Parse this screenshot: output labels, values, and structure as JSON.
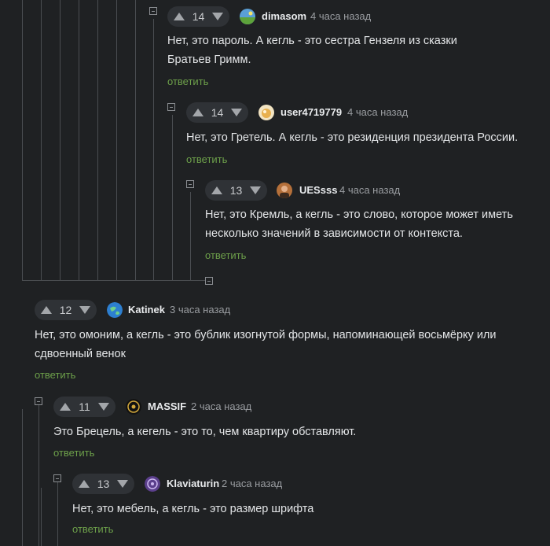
{
  "comments": [
    {
      "votes": "14",
      "author": "dimasom",
      "time": "4 часа назад",
      "text_lines": [
        "Нет, это пароль. А кегль - это сестра Гензеля из сказки",
        "Братьев Гримм."
      ],
      "reply": "ответить",
      "avatar": "landscape-avatar"
    },
    {
      "votes": "14",
      "author": "user4719779",
      "time": "4 часа назад",
      "text_lines": [
        "Нет, это Гретель. А кегль - это резиденция президента России."
      ],
      "reply": "ответить",
      "avatar": "food-avatar"
    },
    {
      "votes": "13",
      "author": "UESsss",
      "time": "4 часа назад",
      "text_lines": [
        "Нет, это Кремль, а кегль - это слово, которое может иметь",
        "несколько значений в зависимости от контекста."
      ],
      "reply": "ответить",
      "avatar": "person-avatar"
    },
    {
      "votes": "12",
      "author": "Katinek",
      "time": "3 часа назад",
      "text_lines": [
        "Нет, это омоним, а кегль - это бублик изогнутой формы, напоминающей восьмёрку или",
        "сдвоенный венок"
      ],
      "reply": "ответить",
      "avatar": "globe-avatar"
    },
    {
      "votes": "11",
      "author": "MASSIF",
      "time": "2 часа назад",
      "text_lines": [
        "Это Брецель, а кегель - это то, чем квартиру обставляют."
      ],
      "reply": "ответить",
      "avatar": "dark-circle-avatar"
    },
    {
      "votes": "13",
      "author": "Klaviaturin",
      "time": "2 часа назад",
      "text_lines": [
        "Нет, это мебель, а кегль - это размер шрифта"
      ],
      "reply": "ответить",
      "avatar": "purple-avatar"
    }
  ]
}
